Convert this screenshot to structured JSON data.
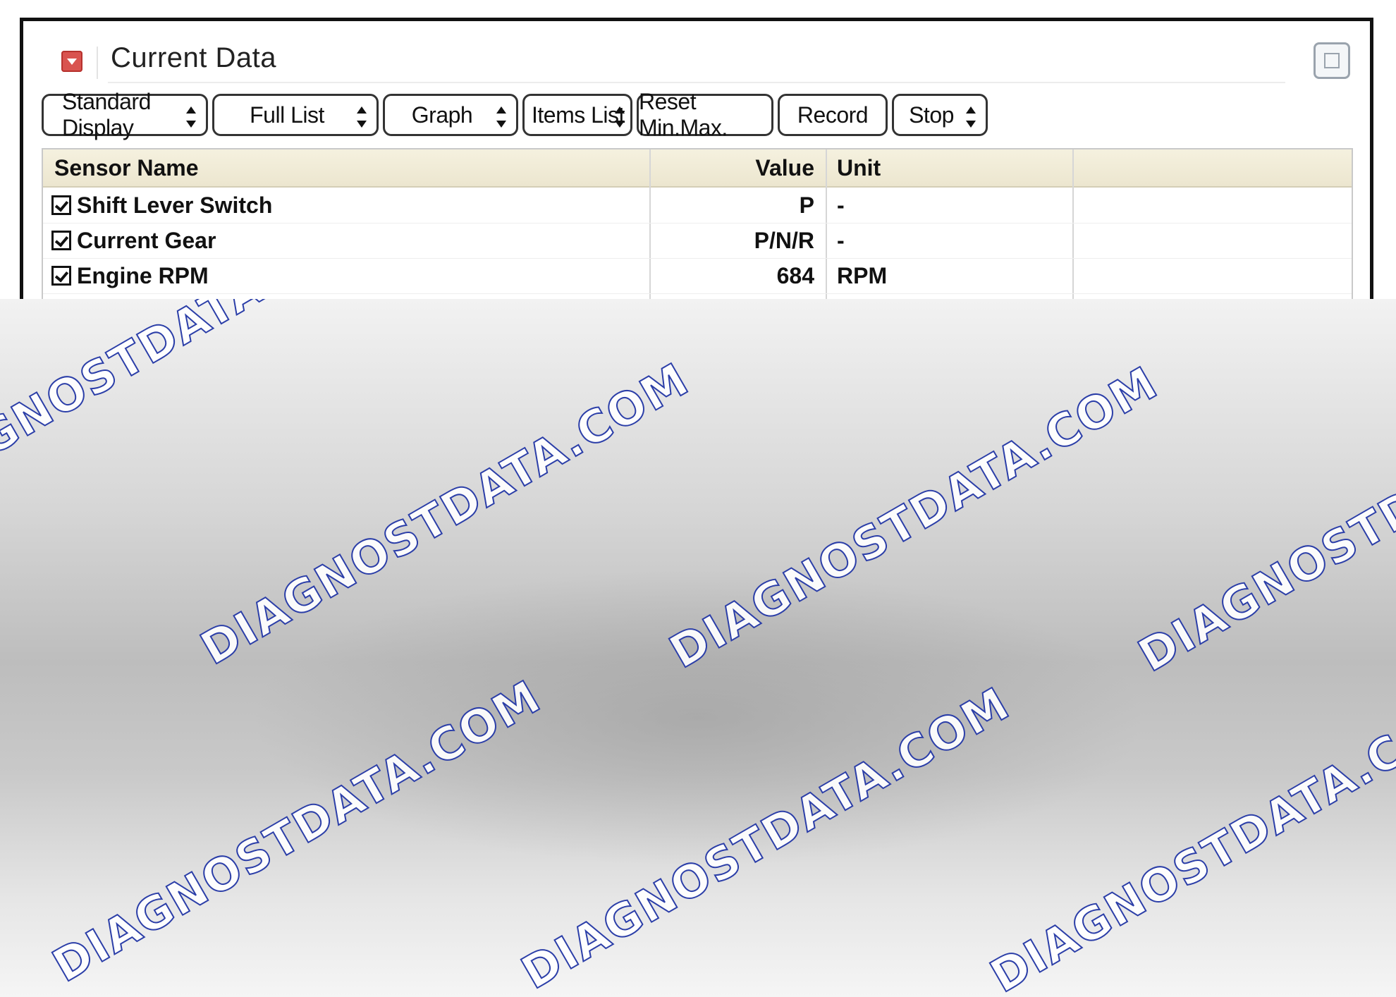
{
  "panel": {
    "title": "Current Data",
    "toolbar": {
      "display_select": "Standard Display",
      "list_select": "Full List",
      "graph_select": "Graph",
      "items_list_select": "Items List",
      "reset_label": "Reset Min.Max.",
      "record_label": "Record",
      "stop_select": "Stop"
    },
    "table": {
      "columns": [
        "Sensor Name",
        "Value",
        "Unit"
      ],
      "rows": [
        {
          "checked": true,
          "name": "Shift Lever Switch",
          "value": "P",
          "unit": "-"
        },
        {
          "checked": true,
          "name": "Current Gear",
          "value": "P/N/R",
          "unit": "-"
        },
        {
          "checked": true,
          "name": "Engine RPM",
          "value": "684",
          "unit": "RPM"
        }
      ]
    }
  },
  "watermark": {
    "text": "DIAGNOSTDATA.COM",
    "color": "#2b3ea8"
  },
  "colors": {
    "collapse_icon": "#d9534f",
    "header_bg": "#f5f1df",
    "frame": "#111111"
  }
}
